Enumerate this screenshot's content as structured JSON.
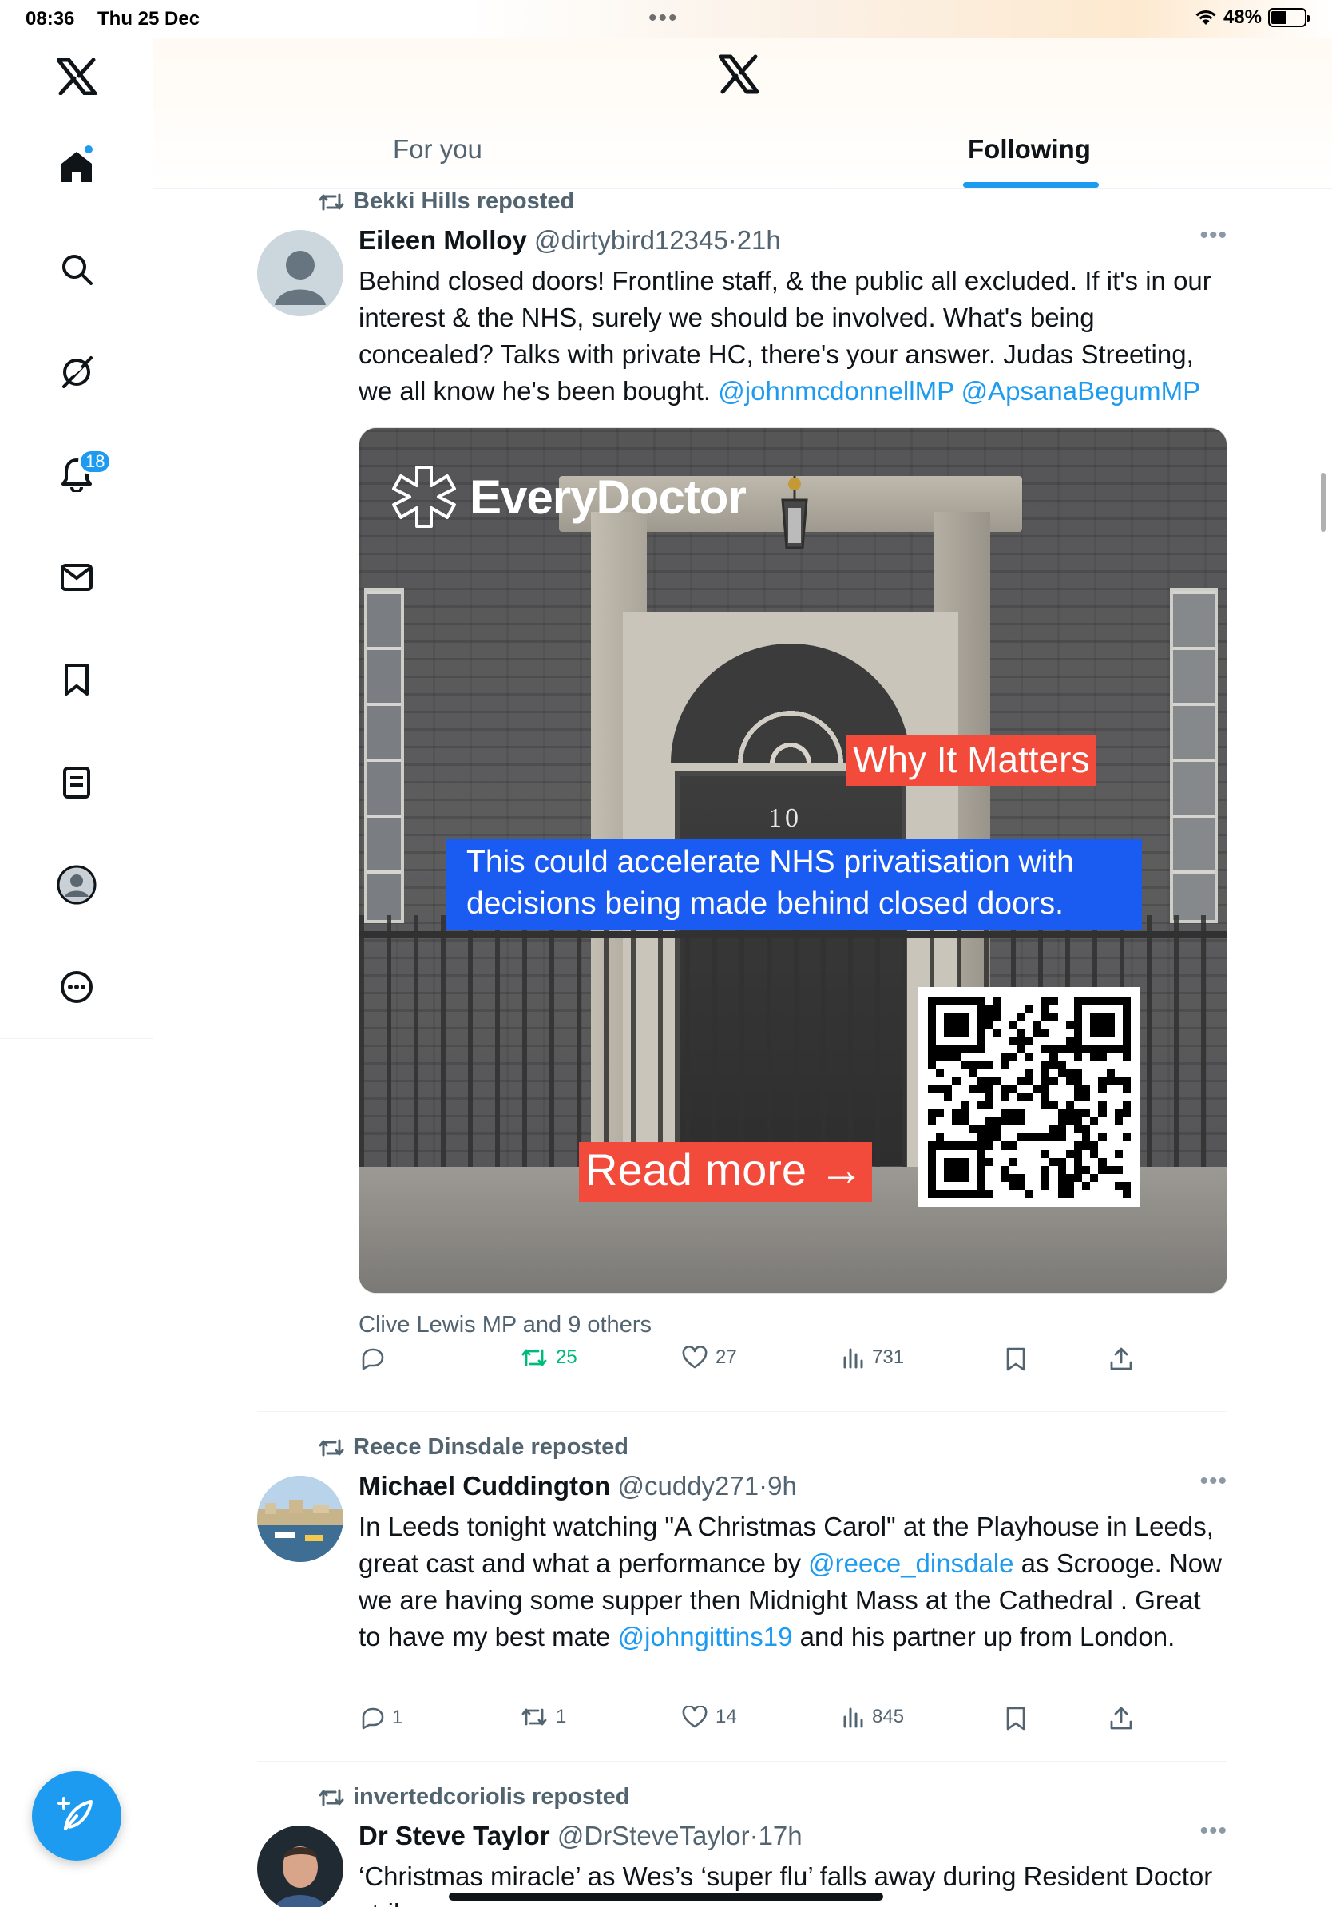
{
  "status_bar": {
    "time": "08:36",
    "date": "Thu 25 Dec",
    "battery": "48%",
    "battery_level": 0.48
  },
  "sidebar": {
    "items": [
      {
        "icon": "x-logo-icon"
      },
      {
        "icon": "home-icon",
        "active": true,
        "dot": true
      },
      {
        "icon": "search-icon"
      },
      {
        "icon": "grok-icon"
      },
      {
        "icon": "bell-icon",
        "badge": "18"
      },
      {
        "icon": "mail-icon"
      },
      {
        "icon": "bookmark-icon"
      },
      {
        "icon": "lists-icon"
      },
      {
        "icon": "profile-avatar"
      },
      {
        "icon": "more-circle-icon"
      }
    ],
    "compose_icon": "compose-feather-icon"
  },
  "header": {
    "tabs": [
      {
        "label": "For you",
        "active": false
      },
      {
        "label": "Following",
        "active": true
      }
    ]
  },
  "colors": {
    "accent": "#1d9bf0",
    "retweet_active": "#00ba7c",
    "muted_text": "#536471",
    "media_red": "#f34b3b",
    "media_blue": "#1a5cf2"
  },
  "feed": {
    "posts": [
      {
        "repost_by": "Bekki Hills reposted",
        "name": "Eileen Molloy",
        "handle": "@dirtybird12345",
        "sep": "·",
        "time": "21h",
        "text_parts": [
          "Behind closed doors! Frontline staff, & the public all excluded. If it's in our interest & the NHS, surely we should be involved. What's being concealed? Talks with private HC, there's your answer. Judas Streeting, we all know he's been bought. "
        ],
        "mentions": [
          "@johnmcdonnellMP",
          "@ApsanaBegumMP"
        ],
        "media": {
          "brand": "EveryDoctor",
          "why_label": "Why It Matters",
          "door_number": "10",
          "message": "This could accelerate NHS privatisation with decisions being made behind closed doors.",
          "cta": "Read more →"
        },
        "liked_by": "Clive Lewis MP and 9 others",
        "replies": "",
        "reposts": "25",
        "likes": "27",
        "views": "731"
      },
      {
        "repost_by": "Reece Dinsdale reposted",
        "name": "Michael Cuddington",
        "handle": "@cuddy271",
        "sep": "·",
        "time": "9h",
        "text_a": "In Leeds tonight watching \"A Christmas Carol\" at the Playhouse in Leeds, great cast and what a performance by ",
        "mention_a": "@reece_dinsdale",
        "text_b": " as Scrooge. Now we are having some supper then Midnight Mass at the Cathedral . Great to have my best mate ",
        "mention_b": "@johngittins19",
        "text_c": " and his partner up from London.",
        "replies": "1",
        "reposts": "1",
        "likes": "14",
        "views": "845"
      },
      {
        "repost_by": "invertedcoriolis reposted",
        "name": "Dr Steve Taylor",
        "handle": "@DrSteveTaylor",
        "sep": "·",
        "time": "17h",
        "text": "‘Christmas miracle’ as Wes’s ‘super flu’ falls away during Resident Doctor strike"
      }
    ]
  }
}
